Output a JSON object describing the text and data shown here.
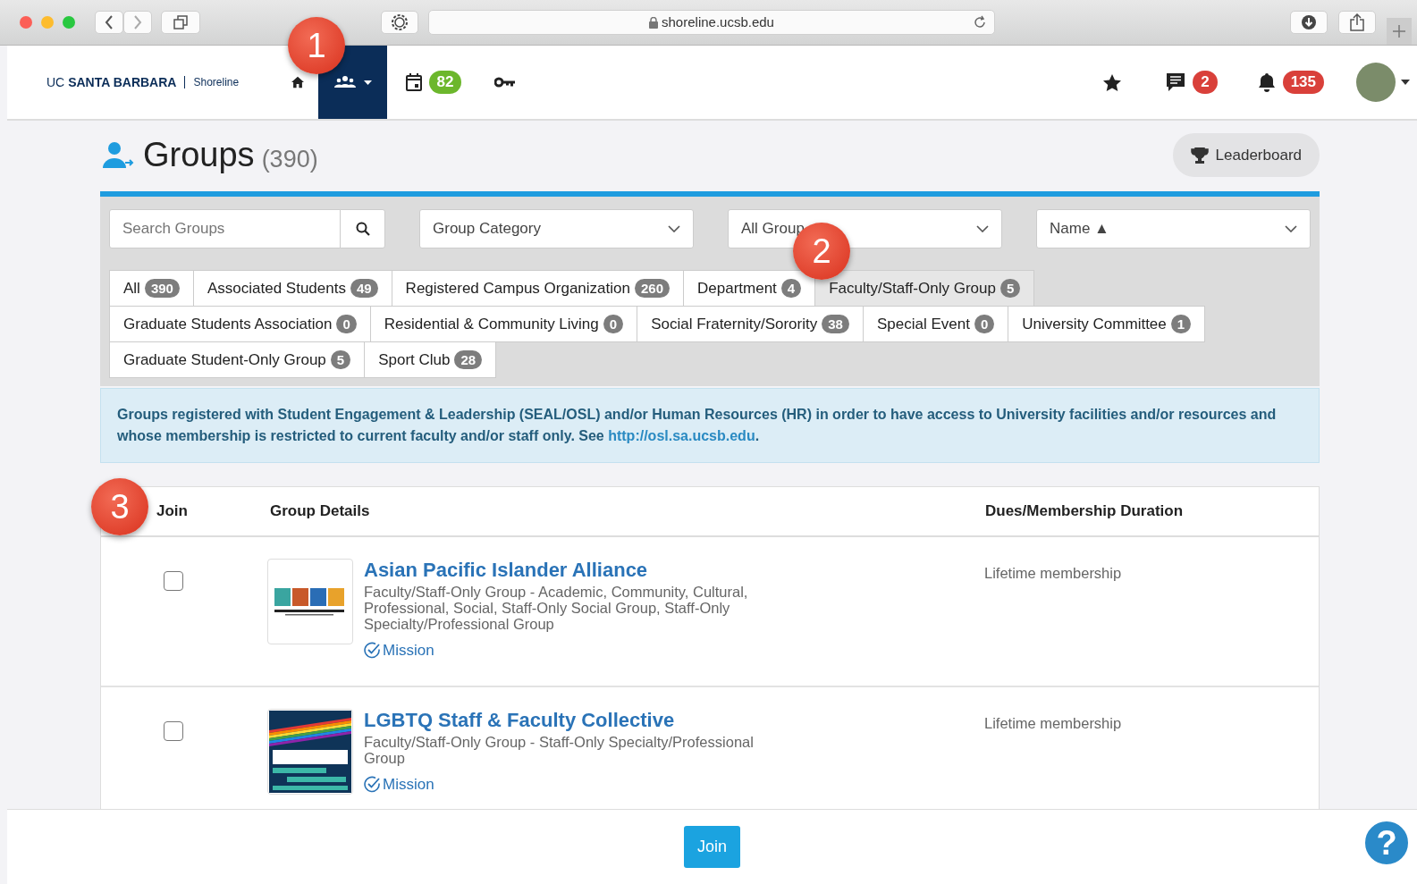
{
  "browser": {
    "url": "shoreline.ucsb.edu"
  },
  "header": {
    "brand": "UC **SANTA BARBARA**",
    "site": "Shoreline",
    "nav": [
      {
        "kind": "home",
        "selected": false
      },
      {
        "kind": "groups",
        "selected": true
      },
      {
        "kind": "calendar",
        "selected": false,
        "badge": "82"
      },
      {
        "kind": "key",
        "selected": false
      }
    ],
    "tools": [
      {
        "kind": "star"
      },
      {
        "kind": "messages",
        "badge": "2"
      },
      {
        "kind": "bell",
        "badge": "135"
      },
      {
        "kind": "avatar"
      }
    ]
  },
  "page": {
    "title": "Groups",
    "count": "(390)",
    "leaderboard": "Leaderboard"
  },
  "filters": {
    "search": {
      "placeholder": "Search Groups"
    },
    "selects": [
      "Group Category",
      "All Group",
      "Name ▲"
    ]
  },
  "categories": [
    {
      "label": "All",
      "count": "390",
      "selected": false
    },
    {
      "label": "Associated Students",
      "count": "49",
      "selected": false
    },
    {
      "label": "Registered Campus Organization",
      "count": "260",
      "selected": false
    },
    {
      "label": "Department",
      "count": "4",
      "selected": false
    },
    {
      "label": "Faculty/Staff-Only Group",
      "count": "5",
      "selected": true
    },
    {
      "label": "Graduate Students Association",
      "count": "0",
      "selected": false
    },
    {
      "label": "Residential & Community Living",
      "count": "0",
      "selected": false
    },
    {
      "label": "Social Fraternity/Sorority",
      "count": "38",
      "selected": false
    },
    {
      "label": "Special Event",
      "count": "0",
      "selected": false
    },
    {
      "label": "University Committee",
      "count": "1",
      "selected": false
    },
    {
      "label": "Graduate Student-Only Group",
      "count": "5",
      "selected": false
    },
    {
      "label": "Sport Club",
      "count": "28",
      "selected": false
    }
  ],
  "info": {
    "text": "Groups registered with Student Engagement & Leadership (SEAL/OSL) and/or Human Resources (HR) in order to have access to University facilities and/or resources and whose membership is restricted to current faculty and/or staff only. See",
    "link": "http://osl.sa.ucsb.edu",
    "after": "."
  },
  "table": {
    "columns": [
      "Join",
      "Group Details",
      "Dues/Membership Duration"
    ],
    "rows": [
      {
        "kind": "apia",
        "checked": false,
        "name": "Asian Pacific Islander Alliance",
        "description": "Faculty/Staff-Only Group - Academic, Community, Cultural, Professional, Social, Staff-Only Social Group, Staff-Only Specialty/Professional Group",
        "mission": "Mission",
        "dues": "Lifetime membership"
      },
      {
        "kind": "lgbtq",
        "checked": false,
        "name": "LGBTQ Staff & Faculty Collective",
        "description": "Faculty/Staff-Only Group - Staff-Only Specialty/Professional Group",
        "mission": "Mission",
        "dues": "Lifetime membership"
      }
    ]
  },
  "footer": {
    "button": "Join",
    "help": "?"
  },
  "callouts": [
    "1",
    "2",
    "3"
  ]
}
